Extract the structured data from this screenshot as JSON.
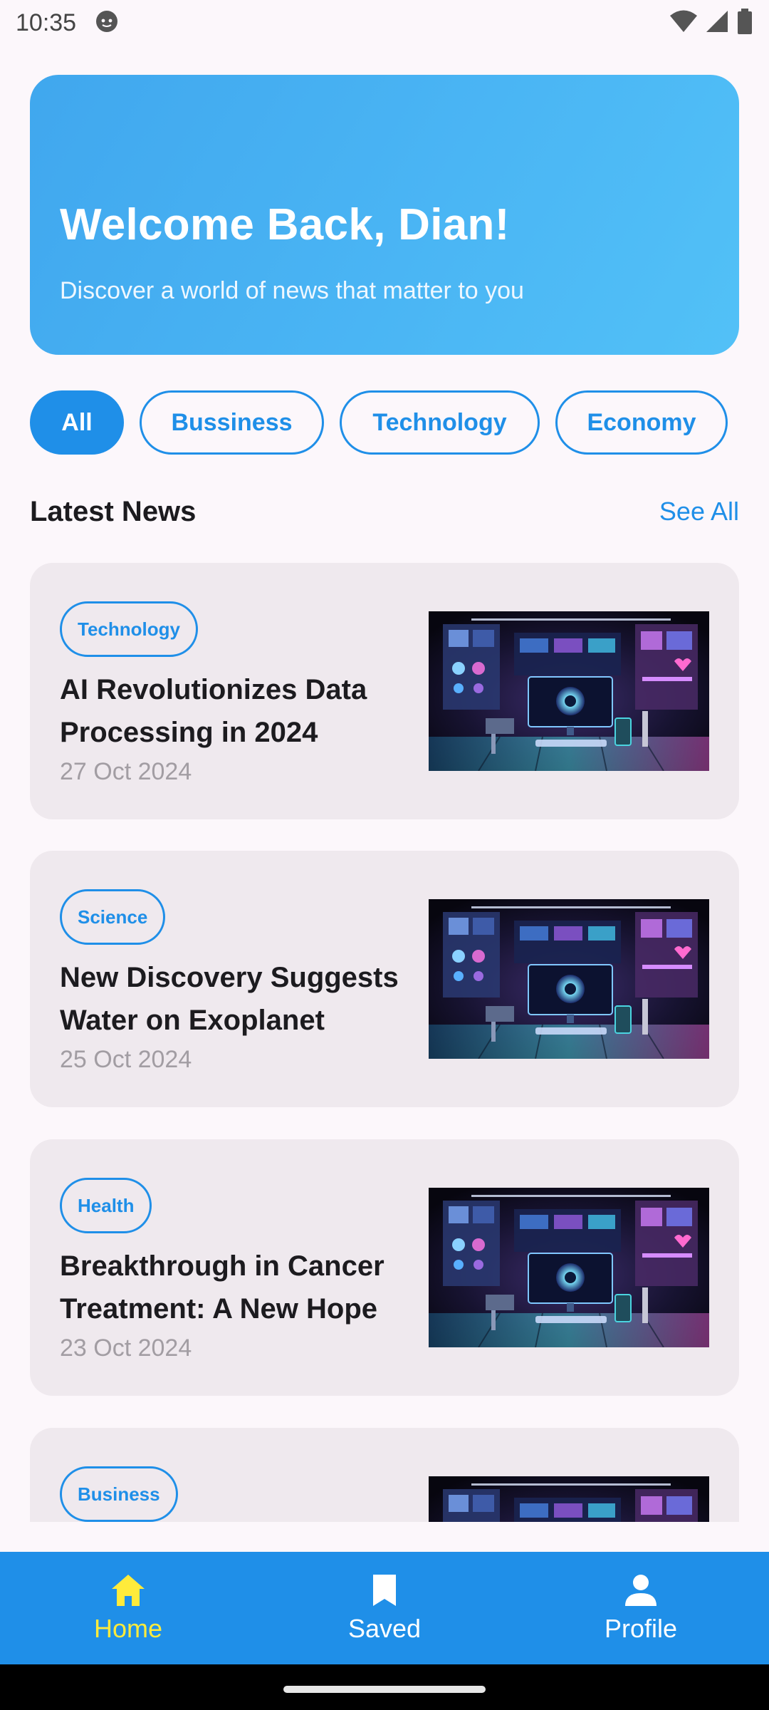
{
  "status_bar": {
    "time": "10:35"
  },
  "hero": {
    "title": "Welcome Back, Dian!",
    "subtitle": "Discover a world of news that matter to you"
  },
  "chips": [
    {
      "label": "All",
      "active": true
    },
    {
      "label": "Bussiness",
      "active": false
    },
    {
      "label": "Technology",
      "active": false
    },
    {
      "label": "Economy",
      "active": false
    }
  ],
  "latest_news": {
    "title": "Latest News",
    "see_all": "See All",
    "items": [
      {
        "tag": "Technology",
        "title": "AI Revolutionizes Data Processing in 2024",
        "date": "27 Oct 2024"
      },
      {
        "tag": "Science",
        "title": "New Discovery Suggests Water on Exoplanet",
        "date": "25 Oct 2024"
      },
      {
        "tag": "Health",
        "title": "Breakthrough in Cancer Treatment: A New Hope",
        "date": "23 Oct 2024"
      },
      {
        "tag": "Business",
        "title": "",
        "date": ""
      }
    ]
  },
  "bottom_nav": [
    {
      "label": "Home",
      "icon": "home-icon",
      "active": true
    },
    {
      "label": "Saved",
      "icon": "bookmark-icon",
      "active": false
    },
    {
      "label": "Profile",
      "icon": "person-icon",
      "active": false
    }
  ],
  "colors": {
    "accent": "#1f8fe8",
    "nav_active": "#ffeb3b",
    "card_bg": "#efe9ee",
    "page_bg": "#fcf7fb"
  }
}
